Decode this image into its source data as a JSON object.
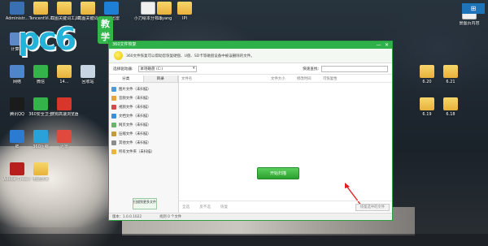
{
  "watermark": {
    "brand": "pc6",
    "tag": "教学"
  },
  "top_right_button": "⊞",
  "desktop_icons": [
    {
      "label": "Administr...",
      "color": "#3b6fb3",
      "kind": "app"
    },
    {
      "label": "TencentVi...",
      "color": "#e9b53c",
      "kind": "folder"
    },
    {
      "label": "截图关键词工具.exe",
      "color": "#e9b53c",
      "kind": "folder"
    },
    {
      "label": "截图关键词",
      "color": "#e9b53c",
      "kind": "folder"
    },
    {
      "label": "极速迅雷",
      "color": "#1d7fd6",
      "kind": "app"
    },
    {
      "label": "小刀绘本分析.pptx",
      "color": "#f0f0f0",
      "kind": "file"
    },
    {
      "label": "18yang",
      "color": "#e9b53c",
      "kind": "folder"
    },
    {
      "label": "IPI",
      "color": "#e9b53c",
      "kind": "folder"
    },
    {
      "label": "计算机",
      "color": "#5d89c6",
      "kind": "app"
    },
    {
      "label": "网络",
      "color": "#4f86c9",
      "kind": "app"
    },
    {
      "label": "微信",
      "color": "#35b24a",
      "kind": "app"
    },
    {
      "label": "14...",
      "color": "#e9b53c",
      "kind": "folder"
    },
    {
      "label": "回收站",
      "color": "#c7d4e2",
      "kind": "app"
    },
    {
      "label": "腾讯QQ",
      "color": "#1b1b1b",
      "kind": "app"
    },
    {
      "label": "360安全卫士",
      "color": "#35b24a",
      "kind": "app"
    },
    {
      "label": "搜狗高速浏览器",
      "color": "#d8362b",
      "kind": "app"
    },
    {
      "label": "IE",
      "color": "#2c7bd3",
      "kind": "app"
    },
    {
      "label": "360压缩",
      "color": "#2aa2d8",
      "kind": "app"
    },
    {
      "label": "迅雷",
      "color": "#e04a3e",
      "kind": "app"
    },
    {
      "label": "Adobe Creati...",
      "color": "#b81e1e",
      "kind": "app"
    },
    {
      "label": "电脑管家",
      "color": "#e9b53c",
      "kind": "folder"
    }
  ],
  "right_icons": [
    {
      "label": "6.20",
      "kind": "folder"
    },
    {
      "label": "6.21",
      "kind": "folder"
    },
    {
      "label": "6.19",
      "kind": "folder"
    },
    {
      "label": "6.18",
      "kind": "folder"
    },
    {
      "label": "景图页内容",
      "kind": "file"
    }
  ],
  "app": {
    "title": "360文件恢复",
    "description": "360文件恢复可以帮助您恢复硬盘、U盘、SD卡等磁盘设备中被误删除的文件。",
    "location_label": "选择驱动器:",
    "location_value": "本地磁盘 (C:)",
    "search_label": "快速查找:",
    "search_placeholder": "",
    "tabs": [
      "分类",
      "目录"
    ],
    "categories": [
      {
        "label": "图片文件（未扫描）",
        "color": "#4e9ad8"
      },
      {
        "label": "音频文件（未扫描）",
        "color": "#e6a23c"
      },
      {
        "label": "视频文件（未扫描）",
        "color": "#d04a4a"
      },
      {
        "label": "文档文件（未扫描）",
        "color": "#3b8fd9"
      },
      {
        "label": "网页文件（未扫描）",
        "color": "#6bb36a"
      },
      {
        "label": "压缩文件（未扫描）",
        "color": "#c39b3a"
      },
      {
        "label": "其他文件（未扫描）",
        "color": "#8c8c8c"
      },
      {
        "label": "所有文件夹（未扫描）",
        "color": "#e9b53c"
      }
    ],
    "scan_button": "扫描到更多文件",
    "columns": [
      "文件名",
      "文件大小",
      "修改时间",
      "可恢复性"
    ],
    "start_button": "开始扫描",
    "bottom_actions": [
      "全选",
      "反不选",
      "恢复"
    ],
    "restore_button": "恢复选中的文件",
    "status_version": "版本：1.0.0.1022",
    "status_count": "找到 0 个文件",
    "window_buttons": [
      "—",
      "✕"
    ]
  }
}
